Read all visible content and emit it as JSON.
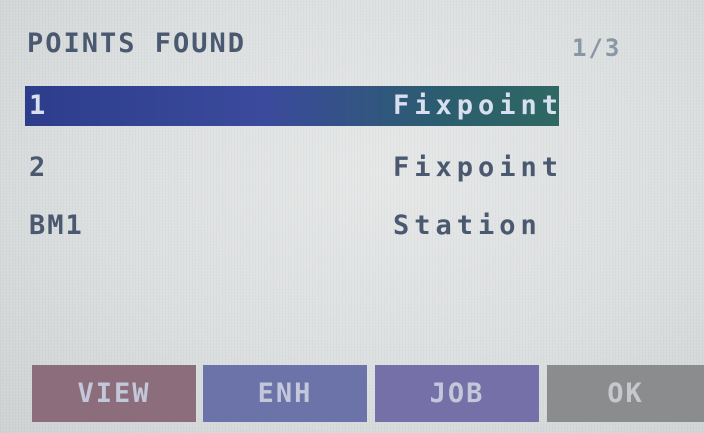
{
  "header": {
    "title": "POINTS FOUND",
    "page": "1/3"
  },
  "points": [
    {
      "id": "1",
      "type": "Fixpoint",
      "selected": true
    },
    {
      "id": "2",
      "type": "Fixpoint",
      "selected": false
    },
    {
      "id": "BM1",
      "type": "Station",
      "selected": false
    }
  ],
  "softkeys": {
    "view": "VIEW",
    "enh": "ENH",
    "job": "JOB",
    "ok": "OK"
  },
  "colors": {
    "background": "#dcdfe0",
    "text": "#4a5870",
    "selection": "#3b4a9c",
    "key_view": "#8b6d7b",
    "key_enh": "#6c73a8",
    "key_job": "#7670a8",
    "key_ok": "#8b8c8e"
  }
}
